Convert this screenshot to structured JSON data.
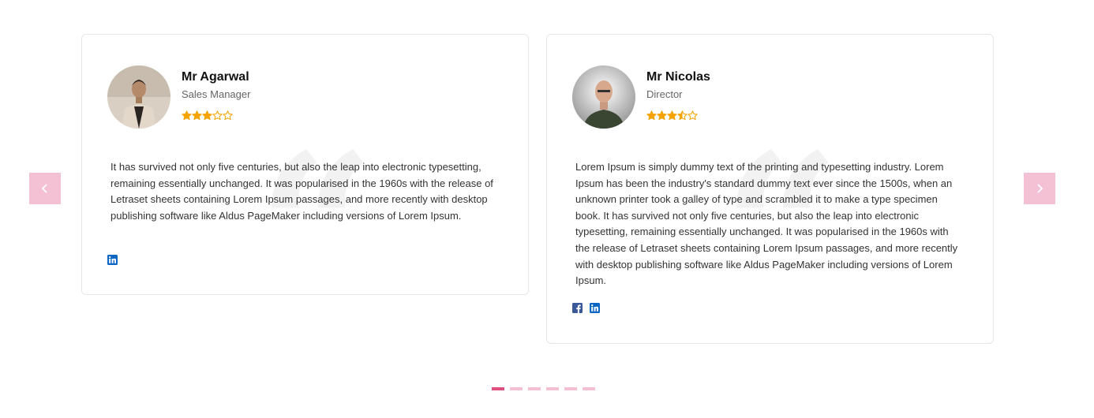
{
  "carousel": {
    "prev_icon": "chevron-left-icon",
    "next_icon": "chevron-right-icon",
    "arrow_color": "#f4c0d3",
    "dot_color": "#f4c0d3",
    "dot_active_color": "#e0507e",
    "dot_count": 6,
    "active_dot": 0
  },
  "star_color": "#f5a300",
  "testimonials": [
    {
      "name": "Mr Agarwal",
      "role": "Sales Manager",
      "rating": 3,
      "text": "It has survived not only five centuries, but also the leap into electronic typesetting, remaining essentially unchanged. It was popularised in the 1960s with the release of Letraset sheets containing Lorem Ipsum passages, and more recently with desktop publishing software like Aldus PageMaker including versions of Lorem Ipsum.",
      "socials": [
        "linkedin-icon"
      ]
    },
    {
      "name": "Mr Nicolas",
      "role": "Director",
      "rating": 3.5,
      "text": "Lorem Ipsum is simply dummy text of the printing and typesetting industry. Lorem Ipsum has been the industry's standard dummy text ever since the 1500s, when an unknown printer took a galley of type and scrambled it to make a type specimen book. It has survived not only five centuries, but also the leap into electronic typesetting, remaining essentially unchanged. It was popularised in the 1960s with the release of Letraset sheets containing Lorem Ipsum passages, and more recently with desktop publishing software like Aldus PageMaker including versions of Lorem Ipsum.",
      "socials": [
        "facebook-icon",
        "linkedin-icon"
      ]
    }
  ]
}
